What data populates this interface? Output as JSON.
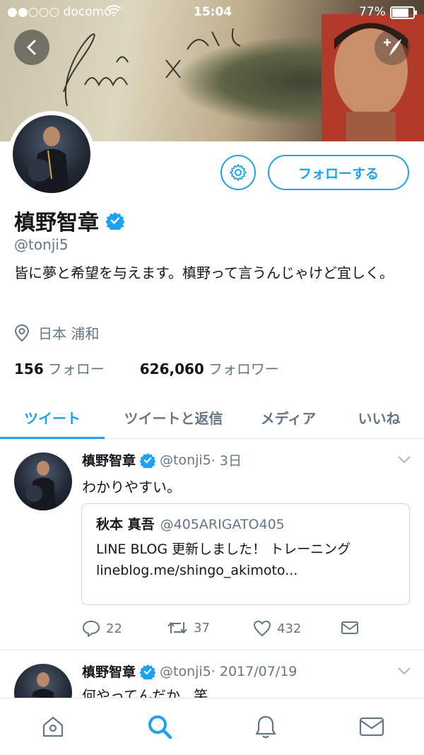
{
  "status_bar": {
    "carrier": "●●○○○ docomo",
    "time": "15:04",
    "battery": "77%"
  },
  "profile": {
    "name": "槙野智章",
    "handle": "@tonji5",
    "bio": "皆に夢と希望を与えます。槙野って言うんじゃけど宜しく。",
    "location": "日本 浦和",
    "following_count": "156",
    "following_label": "フォロー",
    "followers_count": "626,060",
    "followers_label": "フォロワー",
    "follow_button": "フォローする",
    "verified_color": "#1da1f2"
  },
  "tabs": [
    {
      "label": "ツイート",
      "active": true
    },
    {
      "label": "ツイートと返信",
      "active": false
    },
    {
      "label": "メディア",
      "active": false
    },
    {
      "label": "いいね",
      "active": false
    }
  ],
  "tweets": [
    {
      "name": "槙野智章",
      "handle": "@tonji5",
      "time": "· 3日",
      "text": "わかりやすい。",
      "quote": {
        "name": "秋本 真吾",
        "handle": "@405ARIGATO405",
        "text": "LINE BLOG 更新しました！ トレーニング lineblog.me/shingo_akimoto..."
      },
      "replies": "22",
      "retweets": "37",
      "likes": "432"
    },
    {
      "name": "槙野智章",
      "handle": "@tonji5",
      "time": "· 2017/07/19",
      "text": "何やってんだか...笑"
    }
  ],
  "accent_color": "#1da1f2",
  "icons": {
    "back": "chevron-left-icon",
    "compose": "compose-icon",
    "settings": "gear-icon",
    "location": "location-pin-icon",
    "verified": "verified-badge-icon",
    "reply": "reply-icon",
    "retweet": "retweet-icon",
    "like": "heart-icon",
    "dm": "envelope-icon",
    "home": "home-icon",
    "search": "search-icon",
    "notifications": "bell-icon",
    "messages": "mail-icon"
  }
}
